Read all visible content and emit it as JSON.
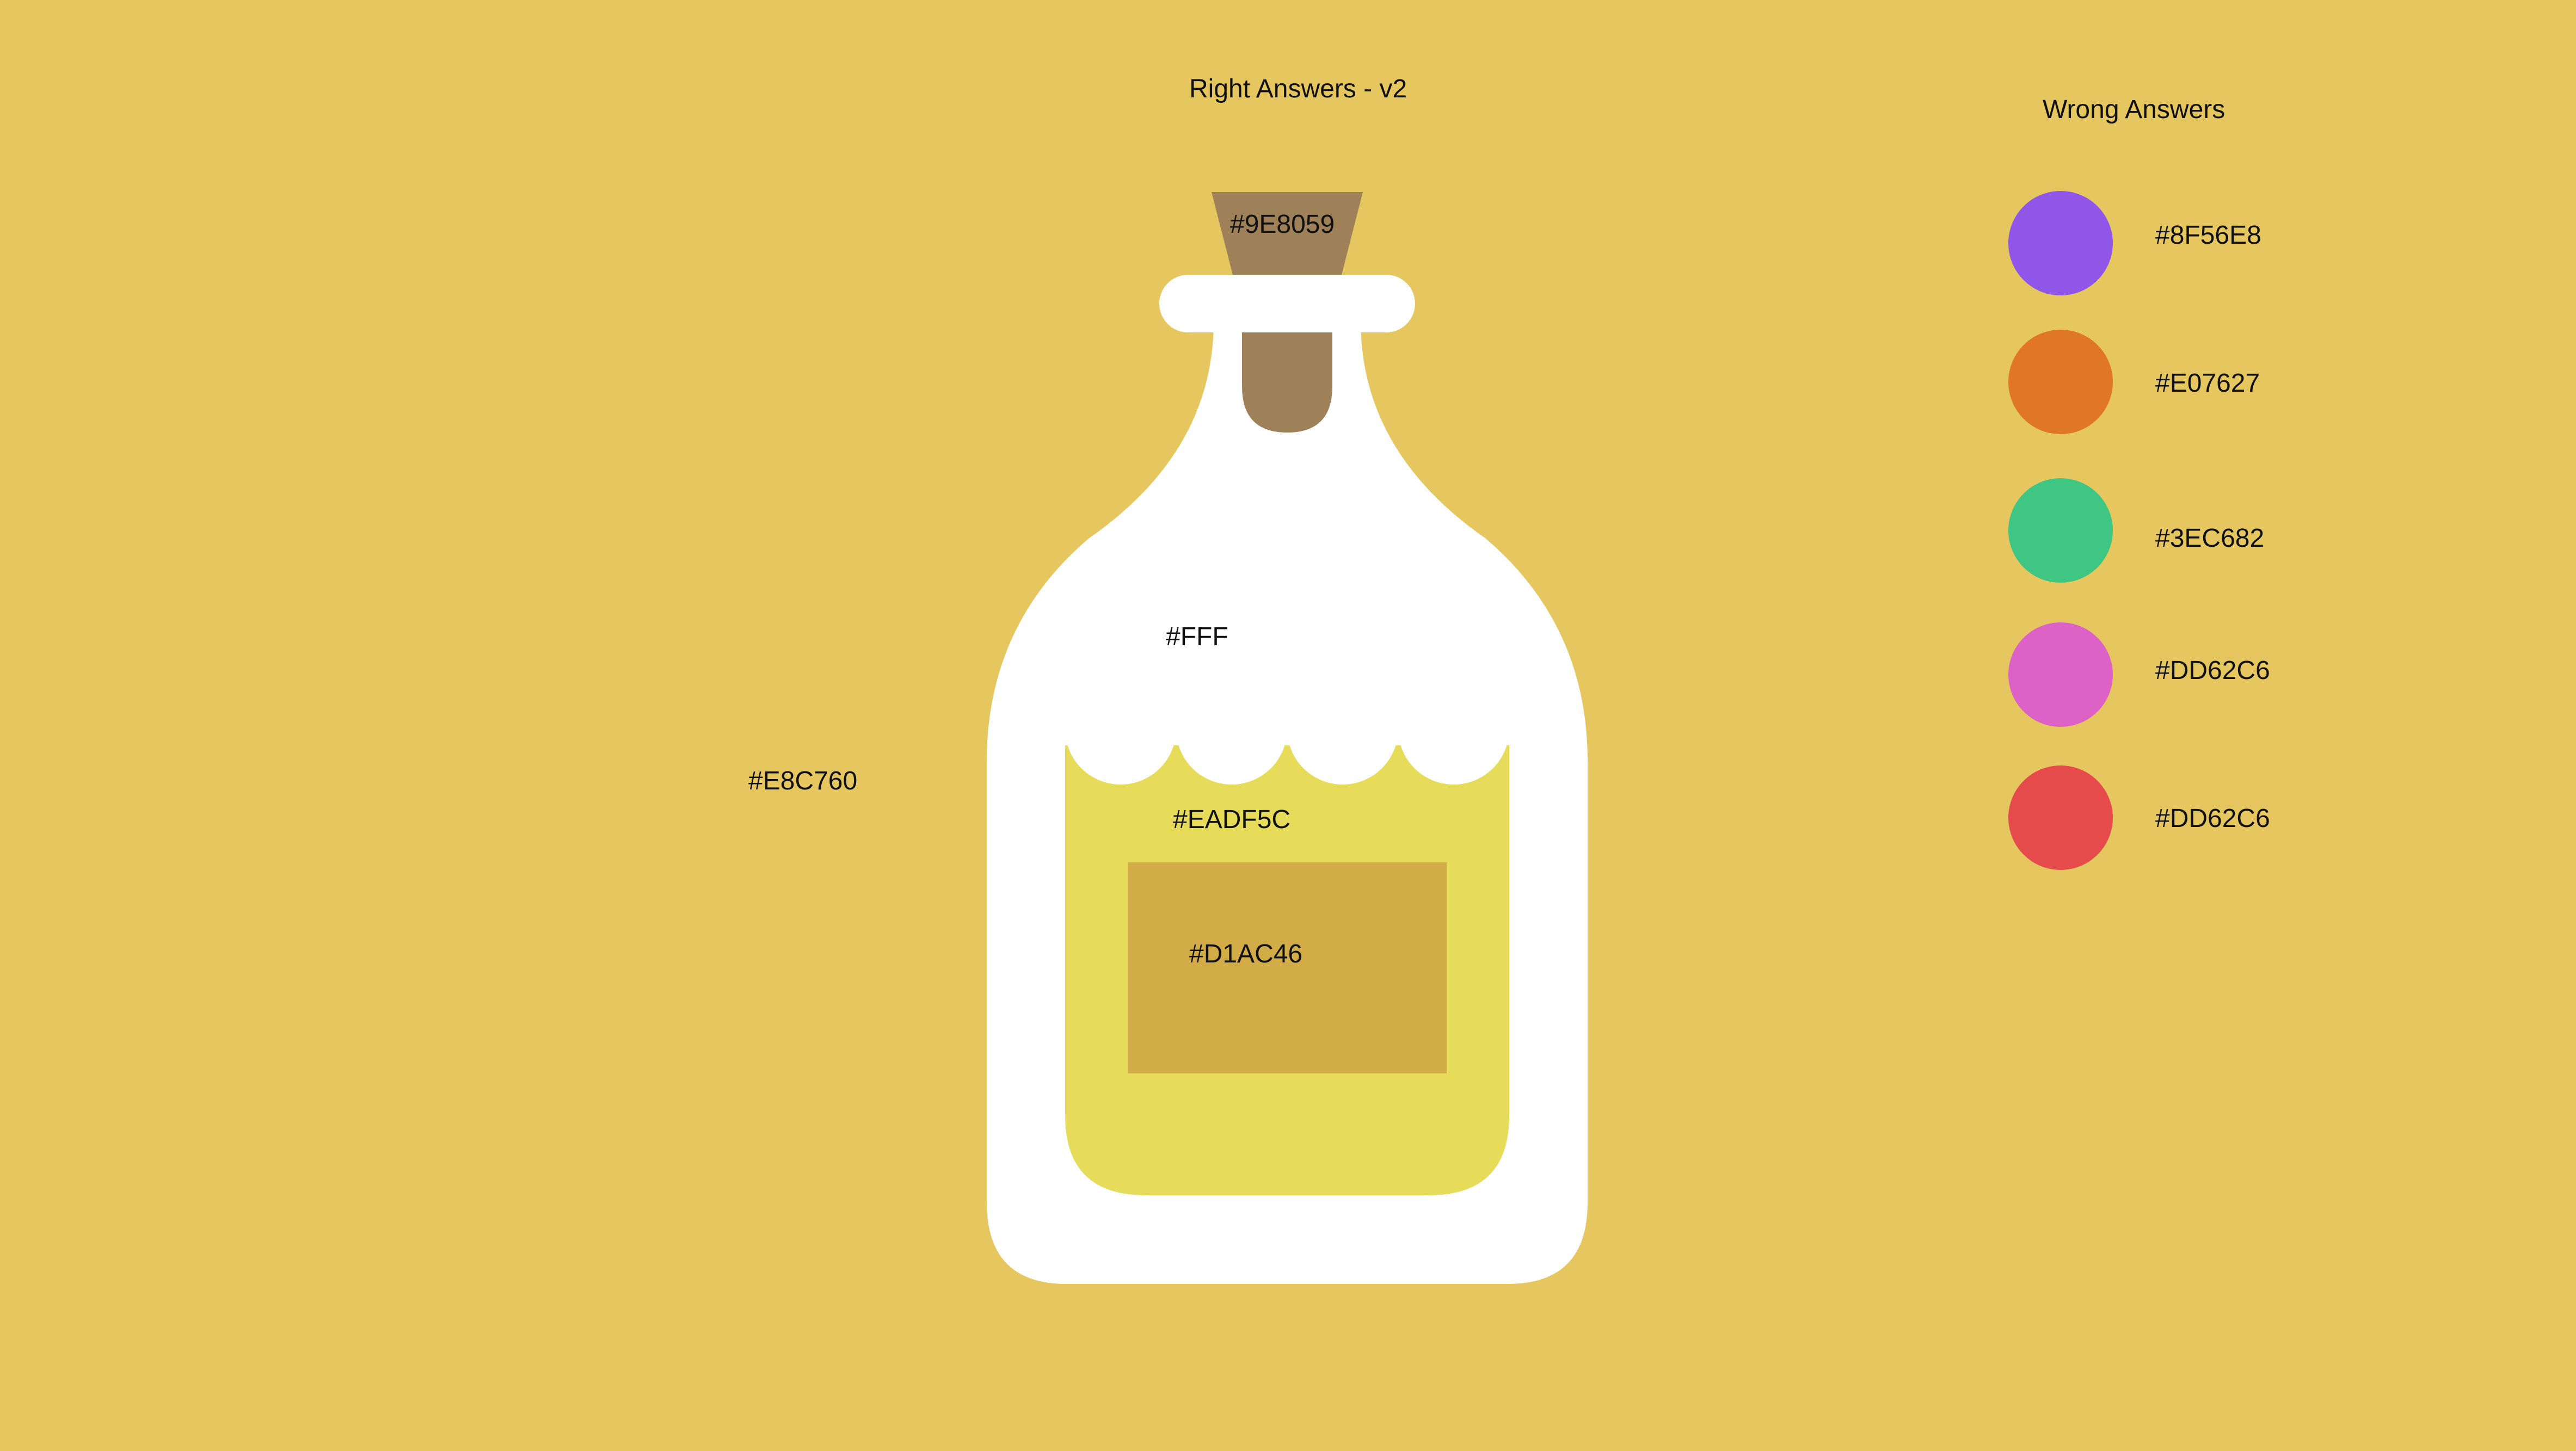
{
  "background_color": "#E6C65F",
  "right_answers": {
    "title": "Right Answers - v2",
    "background_label": "#E8C760",
    "cork_label": "#9E8059",
    "bottle_label": "#FFF",
    "liquid_label": "#EADF5C",
    "label_label": "#D1AC46",
    "colors": {
      "cork": "#9E8059",
      "bottle": "#FFFFFF",
      "liquid": "#E6DC5A",
      "label": "#D2AD47"
    }
  },
  "wrong_answers": {
    "title": "Wrong Answers",
    "swatches": [
      {
        "label": "#8F56E8",
        "color": "#8F56E8"
      },
      {
        "label": "#E07627",
        "color": "#E07627"
      },
      {
        "label": "#3EC682",
        "color": "#3EC682"
      },
      {
        "label": "#DD62C6",
        "color": "#DD62C6"
      },
      {
        "label": "#DD62C6",
        "color": "#E54B4B"
      }
    ]
  }
}
